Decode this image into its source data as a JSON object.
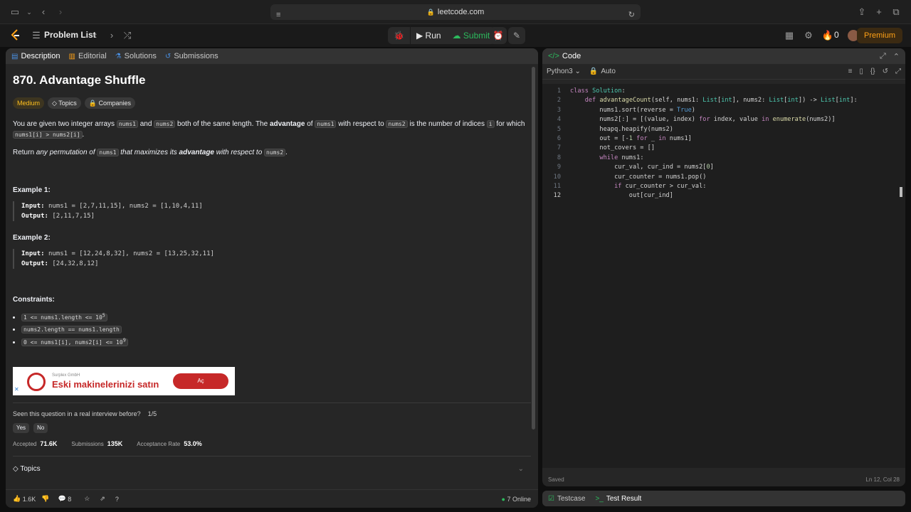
{
  "browser": {
    "url": "leetcode.com"
  },
  "nav": {
    "problem_list": "Problem List",
    "run": "Run",
    "submit": "Submit",
    "streak": "0",
    "premium": "Premium"
  },
  "left_tabs": [
    "Description",
    "Editorial",
    "Solutions",
    "Submissions"
  ],
  "problem": {
    "title": "870. Advantage Shuffle",
    "difficulty": "Medium",
    "tag_topics": "Topics",
    "tag_companies": "Companies",
    "p1_a": "You are given two integer arrays",
    "code_nums1": "nums1",
    "p1_b": "and",
    "code_nums2": "nums2",
    "p1_c": "both of the same length. The",
    "p1_adv": "advantage",
    "p1_d": "of",
    "p1_e": "with respect to",
    "p1_f": "is the number of indices",
    "code_i": "i",
    "p1_g": "for which",
    "code_cond": "nums1[i] > nums2[i]",
    "p2_a": "Return",
    "p2_b": "any permutation of",
    "p2_c": "that maximizes its",
    "p2_d": "advantage",
    "p2_e": "with respect to",
    "ex1_title": "Example 1:",
    "ex1_input_label": "Input:",
    "ex1_input": "nums1 = [2,7,11,15], nums2 = [1,10,4,11]",
    "ex1_output_label": "Output:",
    "ex1_output": "[2,11,7,15]",
    "ex2_title": "Example 2:",
    "ex2_input_label": "Input:",
    "ex2_input": "nums1 = [12,24,8,32], nums2 = [13,25,32,11]",
    "ex2_output_label": "Output:",
    "ex2_output": "[24,32,8,12]",
    "constraints_title": "Constraints:",
    "c1": "1 <= nums1.length <= 10",
    "c1_sup": "5",
    "c2": "nums2.length == nums1.length",
    "c3": "0 <= nums1[i], nums2[i] <= 10",
    "c3_sup": "9"
  },
  "ad": {
    "sub": "Surplex GmbH",
    "title": "Eski makinelerinizi satın",
    "button": "Aç"
  },
  "feedback": {
    "question": "Seen this question in a real interview before?",
    "count": "1/5",
    "yes": "Yes",
    "no": "No"
  },
  "stats": {
    "accepted_label": "Accepted",
    "accepted": "71.6K",
    "submissions_label": "Submissions",
    "submissions": "135K",
    "rate_label": "Acceptance Rate",
    "rate": "53.0%"
  },
  "topics_label": "Topics",
  "bottom": {
    "likes": "1.6K",
    "comments": "8",
    "online": "7 Online"
  },
  "editor": {
    "tab": "Code",
    "language": "Python3",
    "mode": "Auto",
    "saved": "Saved",
    "cursor": "Ln 12, Col 28"
  },
  "code_lines": [
    "class Solution:",
    "    def advantageCount(self, nums1: List[int], nums2: List[int]) -> List[int]:",
    "        nums1.sort(reverse = True)",
    "        nums2[:] = [(value, index) for index, value in enumerate(nums2)]",
    "        heapq.heapify(nums2)",
    "        out = [-1 for _ in nums1]",
    "        not_covers = []",
    "        while nums1:",
    "            cur_val, cur_ind = nums2[0]",
    "            cur_counter = nums1.pop()",
    "            if cur_counter > cur_val:",
    "                out[cur_ind]"
  ],
  "test_tabs": {
    "testcase": "Testcase",
    "result": "Test Result"
  }
}
